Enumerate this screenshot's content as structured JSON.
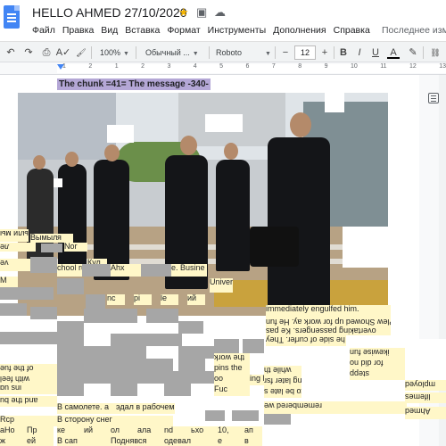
{
  "document": {
    "title": "HELLO AHMED 27/10/2020"
  },
  "icons": {
    "docs": "docs-icon",
    "star": "star-icon",
    "move": "move-to-folder-icon",
    "cloud": "cloud-status-icon",
    "undo": "undo-icon",
    "redo": "redo-icon",
    "print": "print-icon",
    "spellcheck": "spellcheck-icon",
    "paint": "paint-format-icon",
    "outline": "outline-icon",
    "link": "link-icon",
    "highlight": "highlight-icon"
  },
  "menu": {
    "items": [
      "Файл",
      "Правка",
      "Вид",
      "Вставка",
      "Формат",
      "Инструменты",
      "Дополнения",
      "Справка"
    ],
    "last_edit": "Последнее изме"
  },
  "toolbar": {
    "zoom": "100%",
    "style": "Обычный ...",
    "font": "Roboto",
    "minus": "−",
    "font_size": "12",
    "plus": "+",
    "bold": "B",
    "italic": "I",
    "underline": "U",
    "text_color": "A",
    "undo": "↶",
    "redo": "↷",
    "print": "⎙",
    "spellcheck": "A✓",
    "paint": "🖌",
    "highlight": "✎",
    "link": "⛓"
  },
  "ruler": {
    "ticks": [
      "1",
      "2",
      "1",
      "2",
      "3",
      "4",
      "5",
      "6",
      "7",
      "8",
      "9",
      "10",
      "11",
      "12",
      "13"
    ]
  },
  "content": {
    "heading": "The chunk =41= The message -340-"
  },
  "colors": {
    "accent": "#4285f4",
    "highlight": "#b4a7d6",
    "star": "#f4b400"
  },
  "tiles_text": [
    "Прибыли мы",
    "Вымылся",
    "я",
    "ле",
    "Nor",
    "Кул",
    "ve",
    "chool ru",
    "Ahx",
    "e. Busine",
    "Universit",
    "immediately engulfed him.",
    "Plew Showed up for work ay. He fun",
    "overtaking passengers. Ke pas",
    "he side of curfer. They",
    "the work",
    "pins the",
    "oo",
    "ing late",
    "Fuc",
    "while th",
    "Jalang later fsr",
    "Ah to be late s",
    "remembered we",
    "B самолете. а",
    "эдал в рабочем",
    "В сторону снег",
    "Rcp",
    "Ahmed",
    "lifemes",
    "mployed",
    "bn sui",
    "and the bu",
    "of the fue",
    "with feel",
    "ikewise fun",
    "for did no",
    "stepp",
    "ке",
    "ий",
    "ол",
    "ала",
    "nd",
    "ьхо",
    "В сап",
    "Поднявся",
    "одевал",
    "aHo",
    "Пр",
    "ж",
    "ей",
    "10,",
    "ап",
    "e",
    "в",
    "M",
    "nc",
    "pi",
    "le",
    "ий"
  ]
}
